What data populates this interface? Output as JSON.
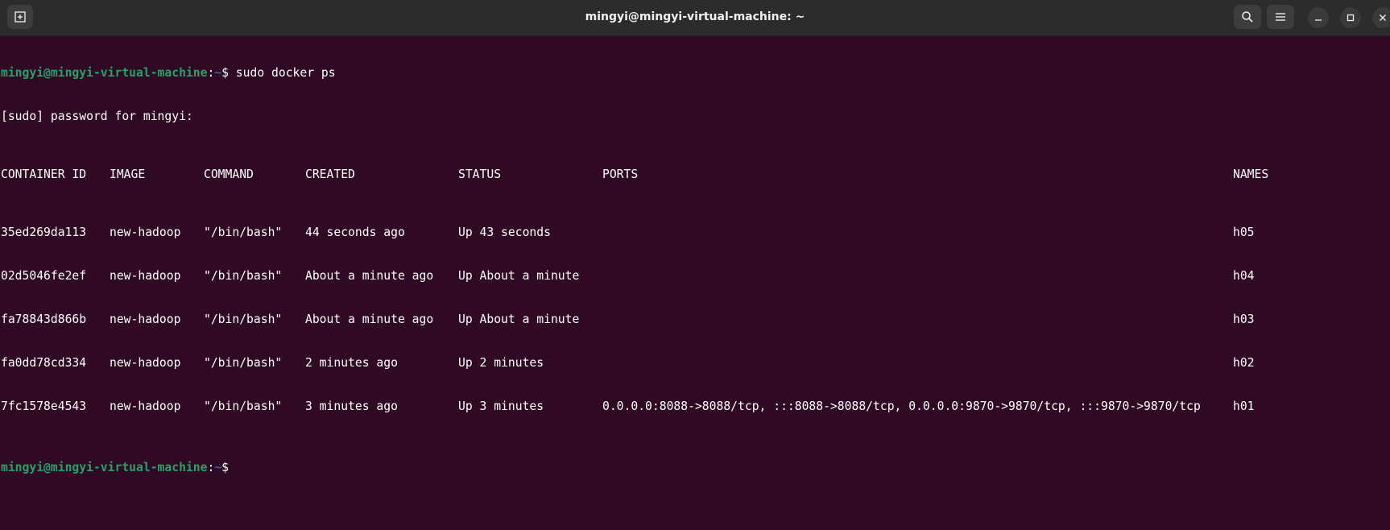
{
  "window": {
    "title": "mingyi@mingyi-virtual-machine: ~"
  },
  "prompt": {
    "user_host": "mingyi@mingyi-virtual-machine",
    "separator": ":",
    "path": "~",
    "symbol": "$"
  },
  "command": " sudo docker ps",
  "sudo_line": "[sudo] password for mingyi:",
  "table": {
    "headers": [
      "CONTAINER ID",
      "IMAGE",
      "COMMAND",
      "CREATED",
      "STATUS",
      "PORTS",
      "NAMES"
    ],
    "rows": [
      [
        "35ed269da113",
        "new-hadoop",
        "\"/bin/bash\"",
        "44 seconds ago",
        "Up 43 seconds",
        "",
        "h05"
      ],
      [
        "02d5046fe2ef",
        "new-hadoop",
        "\"/bin/bash\"",
        "About a minute ago",
        "Up About a minute",
        "",
        "h04"
      ],
      [
        "fa78843d866b",
        "new-hadoop",
        "\"/bin/bash\"",
        "About a minute ago",
        "Up About a minute",
        "",
        "h03"
      ],
      [
        "fa0dd78cd334",
        "new-hadoop",
        "\"/bin/bash\"",
        "2 minutes ago",
        "Up 2 minutes",
        "",
        "h02"
      ],
      [
        "7fc1578e4543",
        "new-hadoop",
        "\"/bin/bash\"",
        "3 minutes ago",
        "Up 3 minutes",
        "0.0.0.0:8088->8088/tcp, :::8088->8088/tcp, 0.0.0.0:9870->9870/tcp, :::9870->9870/tcp",
        "h01"
      ]
    ]
  },
  "icons": {
    "new_tab": "new-tab-icon",
    "search": "search-icon",
    "menu": "hamburger-menu-icon",
    "minimize": "minimize-icon",
    "maximize": "maximize-icon",
    "close": "close-icon"
  },
  "colors": {
    "background": "#300a24",
    "titlebar": "#2c2c2c",
    "prompt_user": "#26a269",
    "prompt_path": "#3465a4",
    "text": "#ffffff"
  }
}
